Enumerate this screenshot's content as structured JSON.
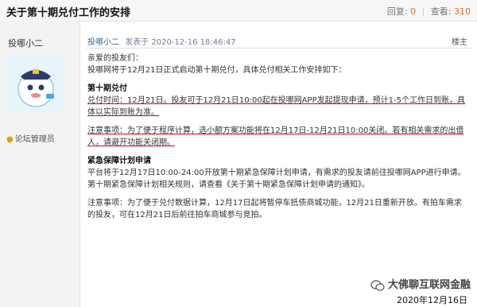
{
  "header": {
    "title": "关于第十期兑付工作的安排",
    "reply_label": "回复:",
    "reply_count": "0",
    "view_label": "查看:",
    "view_count": "310"
  },
  "user": {
    "name": "投哪小二",
    "role": "论坛管理员"
  },
  "post": {
    "author": "投哪小二",
    "datetime": "发表于 2020-12-16 18:46:47",
    "floor": "楼主",
    "greeting": "亲爱的投友们：",
    "intro": "投哪网将于12月21日正式启动第十期兑付，具体兑付相关工作安排如下：",
    "section1_title": "第十期兑付",
    "section1_text": "兑付时间：12月21日。投友可于12月21日10:00起在投哪网APP发起提现申请，预计1-5个工作日到账，具体以实际到账为准。",
    "section1_note": "注意事项：为了便于程序计算，选小额方案功能将在12月17日-12月21日10:00关闭。若有相关需求的出借人，请避开功能关闭期。",
    "section2_title": "紧急保障计划申请",
    "section2_text": "平台将于12月17日10:00-24:00开放第十期紧急保障计划申请，有需求的投友请前往投哪网APP进行申请。第十期紧急保障计划相关规则，请查看《关于第十期紧急保障计划申请的通知》。",
    "section2_note": "注意事项：为了便于兑付数据计算，12月17日起将暂停车抵债商城功能，12月21日重新开放。有拍车需求的投友，可在12月21日后前往拍车商城参与竞拍。"
  },
  "watermark": "大佛聊互联网金融",
  "date_stamp": "2020年12月16日"
}
